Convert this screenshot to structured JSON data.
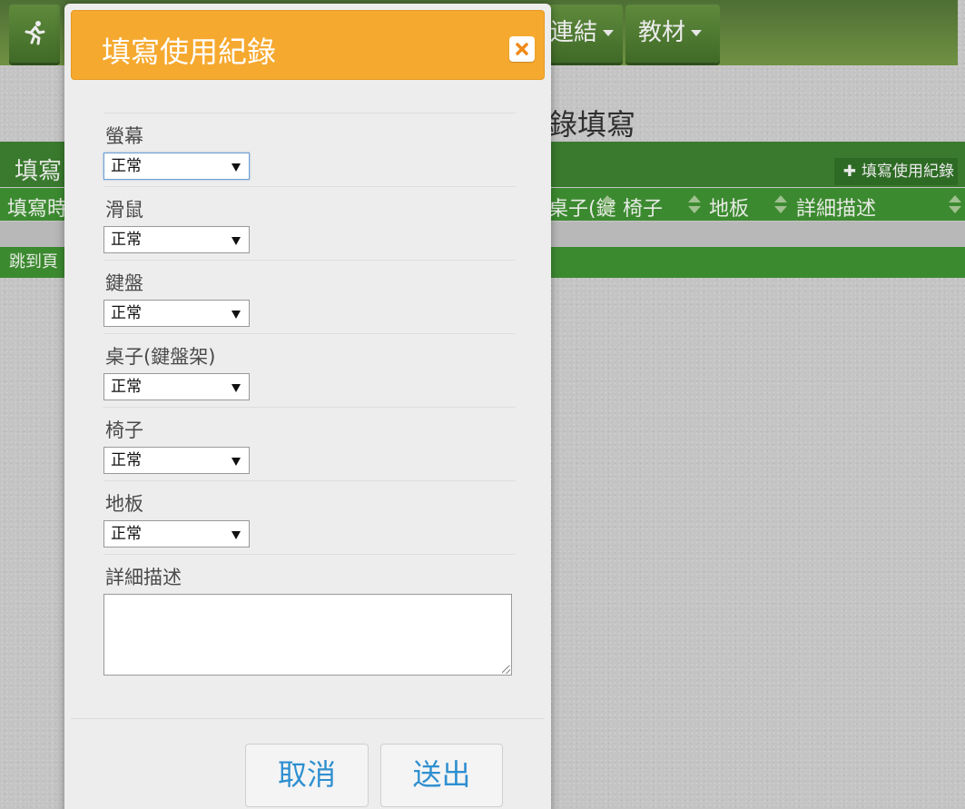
{
  "navbar": {
    "items": [
      {
        "label": "連結"
      },
      {
        "label": "教材"
      }
    ]
  },
  "page": {
    "heading": "錄填寫"
  },
  "panel": {
    "title": "填寫",
    "add_button_label": "填寫使用紀錄"
  },
  "table": {
    "columns": [
      {
        "label": "填寫時"
      },
      {
        "label": "桌子(鍵"
      },
      {
        "label": "椅子"
      },
      {
        "label": "地板"
      },
      {
        "label": "詳細描述"
      }
    ]
  },
  "pager": {
    "jump_label": "跳到頁"
  },
  "modal": {
    "title": "填寫使用紀錄",
    "fields": [
      {
        "label": "螢幕",
        "value": "正常"
      },
      {
        "label": "滑鼠",
        "value": "正常"
      },
      {
        "label": "鍵盤",
        "value": "正常"
      },
      {
        "label": "桌子(鍵盤架)",
        "value": "正常"
      },
      {
        "label": "椅子",
        "value": "正常"
      },
      {
        "label": "地板",
        "value": "正常"
      }
    ],
    "description": {
      "label": "詳細描述",
      "value": ""
    },
    "cancel_label": "取消",
    "submit_label": "送出"
  },
  "colors": {
    "modal_header": "#f6a92f",
    "navbar_green": "#4e6f35",
    "panel_green": "#3a7a2e",
    "button_text_blue": "#2e8fd0"
  }
}
